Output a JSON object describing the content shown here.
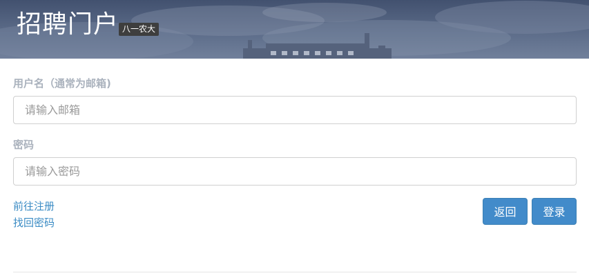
{
  "header": {
    "title": "招聘门户",
    "badge": "八一农大"
  },
  "login_form": {
    "username_label": "用户名（通常为邮箱)",
    "username_placeholder": "请输入邮箱",
    "password_label": "密码",
    "password_placeholder": "请输入密码",
    "register_link": "前往注册",
    "forgot_link": "找回密码",
    "back_button": "返回",
    "login_button": "登录"
  },
  "colors": {
    "primary_button": "#428bca",
    "link": "#3a8bc4",
    "label": "#aab2bd"
  }
}
